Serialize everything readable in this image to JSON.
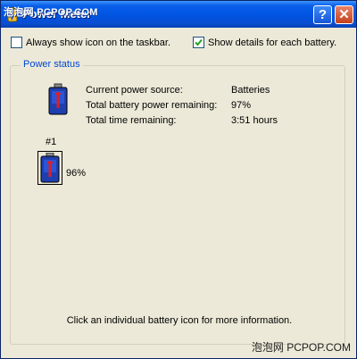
{
  "watermark": {
    "top": "泡泡网 PCPOP.COM",
    "bottom": "泡泡网 PCPOP.COM"
  },
  "window": {
    "title": "Power Meter",
    "help_label": "?",
    "close_label": "✕"
  },
  "options": {
    "show_icon": {
      "label": "Always show icon on the taskbar.",
      "checked": false
    },
    "show_details": {
      "label": "Show details for each battery.",
      "checked": true
    }
  },
  "power_status": {
    "legend": "Power status",
    "rows": [
      {
        "label": "Current power source:",
        "value": "Batteries"
      },
      {
        "label": "Total battery power remaining:",
        "value": "97%"
      },
      {
        "label": "Total time remaining:",
        "value": "3:51 hours"
      }
    ],
    "battery": {
      "name": "#1",
      "percent": "96%"
    },
    "footer": "Click an individual battery icon for more information."
  },
  "colors": {
    "title_bar": "#0054e3",
    "legend_text": "#0046d5",
    "battery_body": "#1f3fae",
    "battery_bar": "#d9202a",
    "window_bg": "#ece9d8"
  }
}
